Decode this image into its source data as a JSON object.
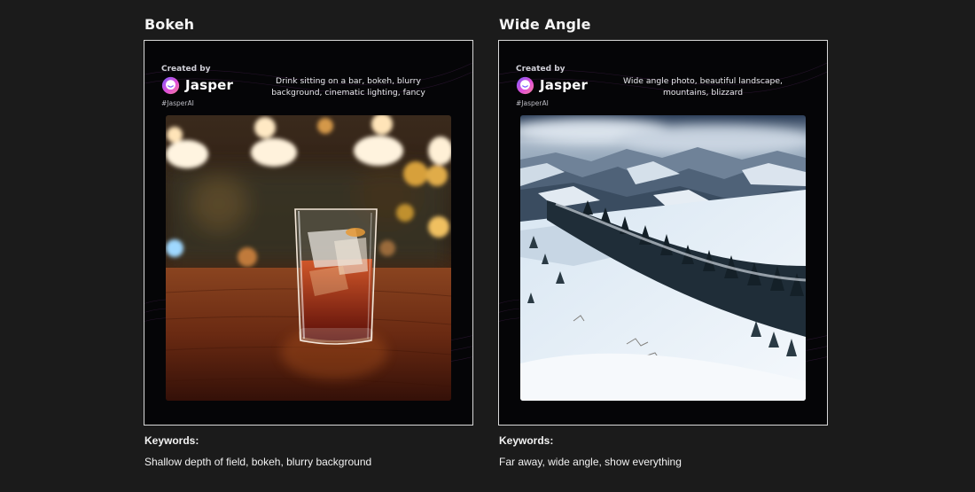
{
  "cards": [
    {
      "title": "Bokeh",
      "created_by": "Created by",
      "brand": "Jasper",
      "hashtag": "#JasperAI",
      "prompt": "Drink sitting on a bar, bokeh, blurry background, cinematic lighting, fancy",
      "keywords_label": "Keywords:",
      "keywords": "Shallow depth of field, bokeh, blurry background",
      "image": "cocktail-glass-on-bar-with-bokeh-lights"
    },
    {
      "title": "Wide Angle",
      "created_by": "Created by",
      "brand": "Jasper",
      "hashtag": "#JasperAI",
      "prompt": "Wide angle photo, beautiful landscape, mountains, blizzard",
      "keywords_label": "Keywords:",
      "keywords": "Far away, wide angle, show everything",
      "image": "snowy-mountain-landscape"
    }
  ],
  "colors": {
    "background": "#1b1b1b",
    "card": "#050507",
    "card_border": "#d9d9d9",
    "logo_gradient": [
      "#7b5cff",
      "#e04fd8",
      "#f27a9b"
    ]
  }
}
